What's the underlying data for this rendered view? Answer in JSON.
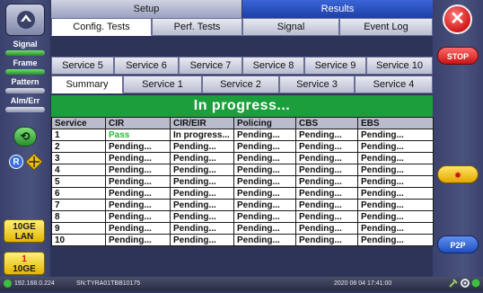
{
  "sidebar": {
    "signal_label": "Signal",
    "frame_label": "Frame",
    "pattern_label": "Pattern",
    "alm_err_label": "Alm/Err",
    "history_glyph": "⟲",
    "r_glyph": "R",
    "tengig_lan_top": "10GE",
    "tengig_lan_bottom": "LAN",
    "port_number": "1",
    "port_speed": "10GE"
  },
  "rightbar": {
    "close_glyph": "✕",
    "stop_label": "STOP",
    "p2p_label": "P2P"
  },
  "tabs": {
    "setup": "Setup",
    "results": "Results"
  },
  "subtabs": [
    "Config. Tests",
    "Perf. Tests",
    "Signal",
    "Event Log"
  ],
  "service_tabs_top": [
    "Service 5",
    "Service 6",
    "Service 7",
    "Service 8",
    "Service 9",
    "Service 10"
  ],
  "service_tabs_bottom": [
    "Summary",
    "Service 1",
    "Service 2",
    "Service 3",
    "Service 4"
  ],
  "banner": "In progress...",
  "table": {
    "headers": [
      "Service",
      "CIR",
      "CIR/EIR",
      "Policing",
      "CBS",
      "EBS"
    ],
    "rows": [
      [
        "1",
        "Pass",
        "In progress...",
        "Pending...",
        "Pending...",
        "Pending..."
      ],
      [
        "2",
        "Pending...",
        "Pending...",
        "Pending...",
        "Pending...",
        "Pending..."
      ],
      [
        "3",
        "Pending...",
        "Pending...",
        "Pending...",
        "Pending...",
        "Pending..."
      ],
      [
        "4",
        "Pending...",
        "Pending...",
        "Pending...",
        "Pending...",
        "Pending..."
      ],
      [
        "5",
        "Pending...",
        "Pending...",
        "Pending...",
        "Pending...",
        "Pending..."
      ],
      [
        "6",
        "Pending...",
        "Pending...",
        "Pending...",
        "Pending...",
        "Pending..."
      ],
      [
        "7",
        "Pending...",
        "Pending...",
        "Pending...",
        "Pending...",
        "Pending..."
      ],
      [
        "8",
        "Pending...",
        "Pending...",
        "Pending...",
        "Pending...",
        "Pending..."
      ],
      [
        "9",
        "Pending...",
        "Pending...",
        "Pending...",
        "Pending...",
        "Pending..."
      ],
      [
        "10",
        "Pending...",
        "Pending...",
        "Pending...",
        "Pending...",
        "Pending..."
      ]
    ]
  },
  "statusbar": {
    "ip": "192.168.0.224",
    "serial": "SN:TYRA01TBB10175",
    "datetime": "2020 08 04  17:41:00"
  },
  "colors": {
    "banner": "#1c9e3c",
    "pass": "#26b835",
    "results_tab": "#1e3fa5",
    "stop": "#c81414"
  }
}
